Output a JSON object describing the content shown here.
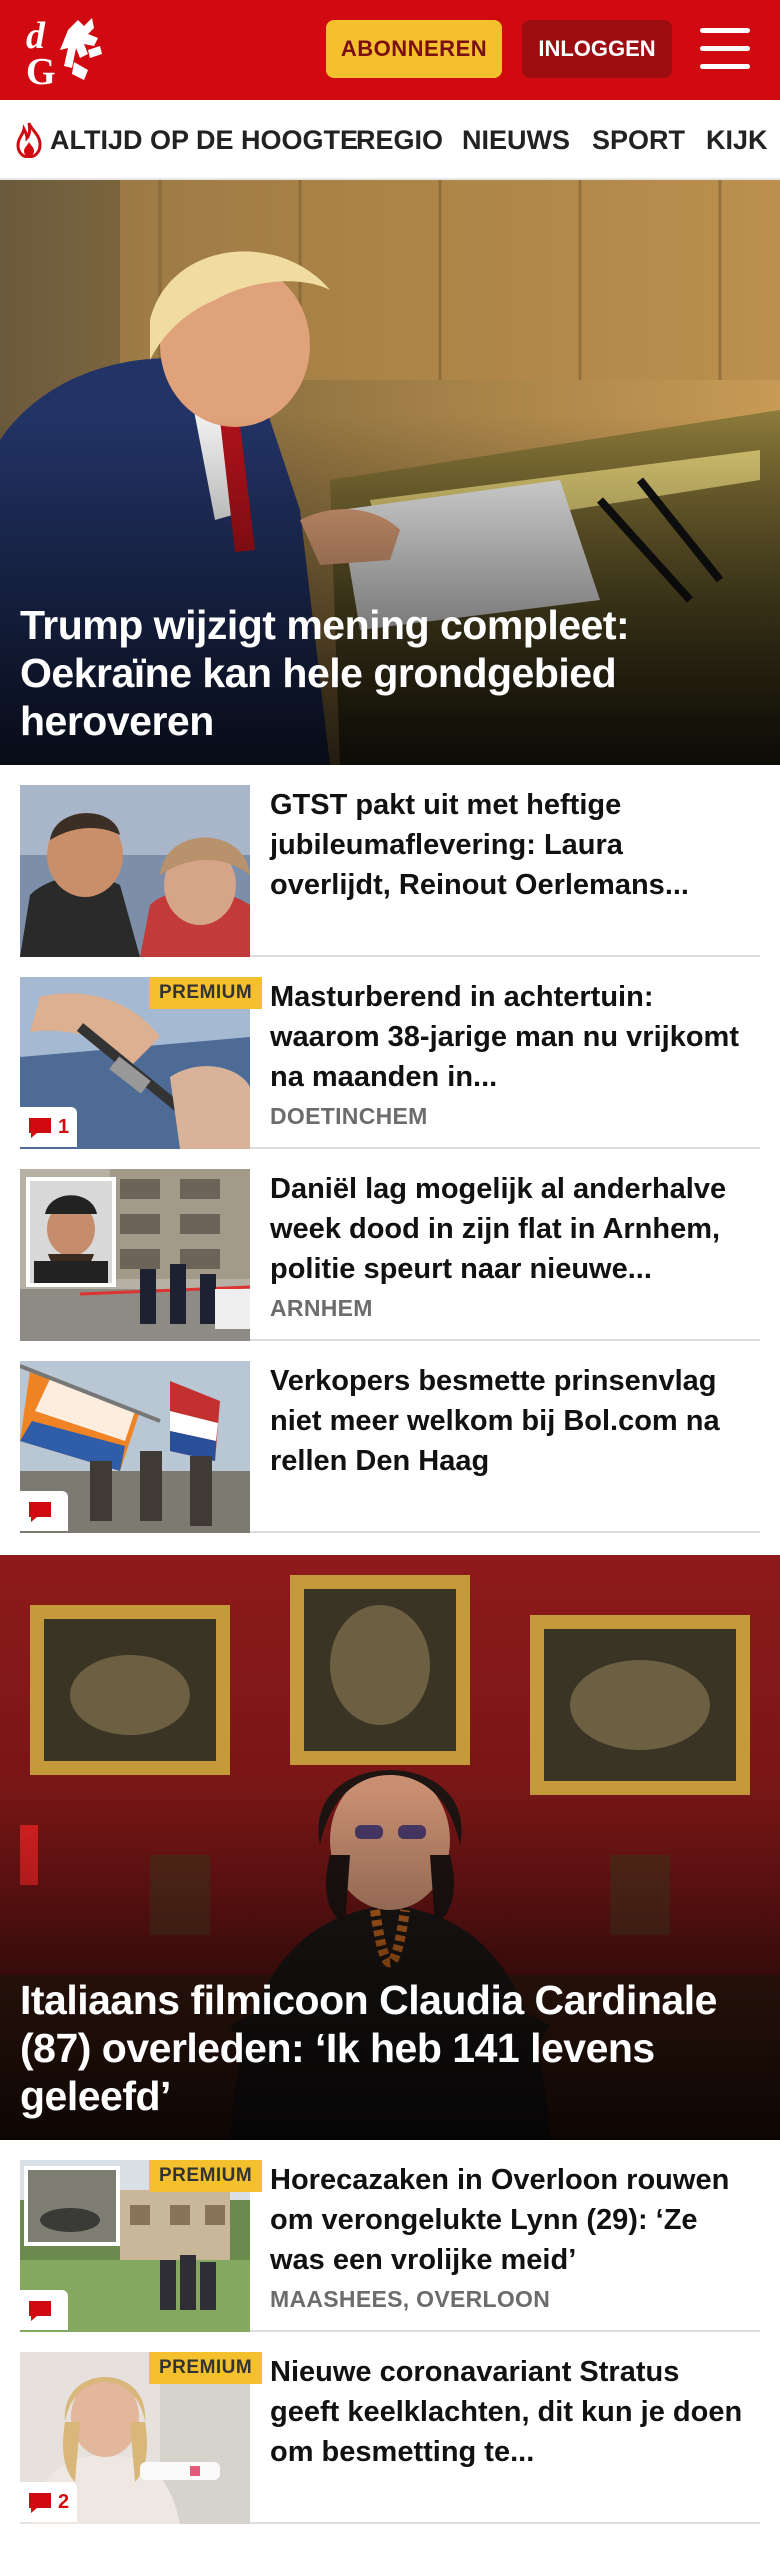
{
  "header": {
    "logo_text": "dG",
    "subscribe_label": "ABONNEREN",
    "login_label": "INLOGGEN"
  },
  "nav": {
    "items": [
      "ALTIJD OP DE HOOGTE",
      "REGIO",
      "NIEUWS",
      "SPORT",
      "KIJK"
    ]
  },
  "hero1": {
    "title": "Trump wijzigt mening compleet: Oekraïne kan hele grondgebied heroveren"
  },
  "articles1": [
    {
      "title": "GTST pakt uit met heftige jubileumaflevering: Laura overlijdt, Reinout Oerlemans...",
      "location": "",
      "premium": false,
      "comments": ""
    },
    {
      "title": "Masturberend in achtertuin: waarom 38-jarige man nu vrijkomt na maanden in...",
      "location": "DOETINCHEM",
      "premium": true,
      "comments": "1"
    },
    {
      "title": "Daniël lag mogelijk al anderhalve week dood in zijn flat in Arnhem, politie speurt naar nieuwe...",
      "location": "ARNHEM",
      "premium": false,
      "comments": ""
    },
    {
      "title": "Verkopers besmette prinsenvlag niet meer welkom bij Bol.com na rellen Den Haag",
      "location": "",
      "premium": false,
      "comments": ""
    }
  ],
  "hero2": {
    "title": "Italiaans filmicoon Claudia Cardinale (87) overleden: ‘Ik heb 141 levens geleefd’"
  },
  "articles2": [
    {
      "title": "Horecazaken in Overloon rouwen om verongelukte Lynn (29): ‘Ze was een vrolijke meid’",
      "location": "MAASHEES, OVERLOON",
      "premium": true,
      "comments": ""
    },
    {
      "title": "Nieuwe coronavariant Stratus geeft keelklachten, dit kun je doen om besmetting te...",
      "location": "",
      "premium": true,
      "comments": "2"
    }
  ],
  "labels": {
    "premium": "PREMIUM"
  },
  "colors": {
    "brand_red": "#d10a11",
    "accent_yellow": "#f4c02e",
    "login_dark_red": "#9c0c10"
  }
}
